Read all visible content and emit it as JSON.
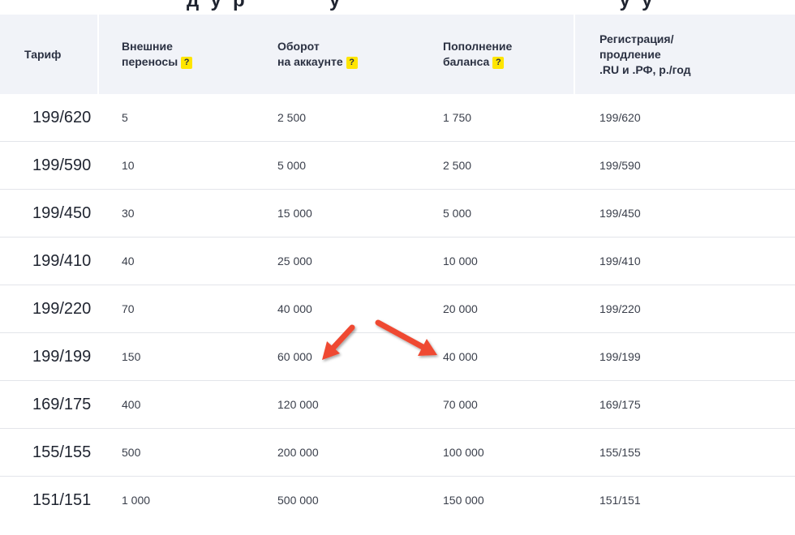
{
  "table": {
    "headers": [
      {
        "line1": "Тариф",
        "line2": "",
        "line3": ""
      },
      {
        "line1": "Внешние",
        "line2": "переносы",
        "line3": ""
      },
      {
        "line1": "Оборот",
        "line2": "на аккаунте",
        "line3": ""
      },
      {
        "line1": "Пополнение",
        "line2": "баланса",
        "line3": ""
      },
      {
        "line1": "Регистрация/",
        "line2": "продление",
        "line3": ".RU и .РФ, р./год"
      }
    ],
    "help_label": "?",
    "rows": [
      {
        "tariff": "199/620",
        "transfers": "5",
        "turnover": "2 500",
        "topup": "1 750",
        "registration": "199/620"
      },
      {
        "tariff": "199/590",
        "transfers": "10",
        "turnover": "5 000",
        "topup": "2 500",
        "registration": "199/590"
      },
      {
        "tariff": "199/450",
        "transfers": "30",
        "turnover": "15 000",
        "topup": "5 000",
        "registration": "199/450"
      },
      {
        "tariff": "199/410",
        "transfers": "40",
        "turnover": "25 000",
        "topup": "10 000",
        "registration": "199/410"
      },
      {
        "tariff": "199/220",
        "transfers": "70",
        "turnover": "40 000",
        "topup": "20 000",
        "registration": "199/220"
      },
      {
        "tariff": "199/199",
        "transfers": "150",
        "turnover": "60 000",
        "topup": "40 000",
        "registration": "199/199"
      },
      {
        "tariff": "169/175",
        "transfers": "400",
        "turnover": "120 000",
        "topup": "70 000",
        "registration": "169/175"
      },
      {
        "tariff": "155/155",
        "transfers": "500",
        "turnover": "200 000",
        "topup": "100 000",
        "registration": "155/155"
      },
      {
        "tariff": "151/151",
        "transfers": "1 000",
        "turnover": "500 000",
        "topup": "150 000",
        "registration": "151/151"
      }
    ]
  },
  "colors": {
    "header_bg": "#f1f3f8",
    "help_badge": "#ffe500",
    "arrow": "#ef4a32",
    "row_divider": "#e3e5ea"
  }
}
